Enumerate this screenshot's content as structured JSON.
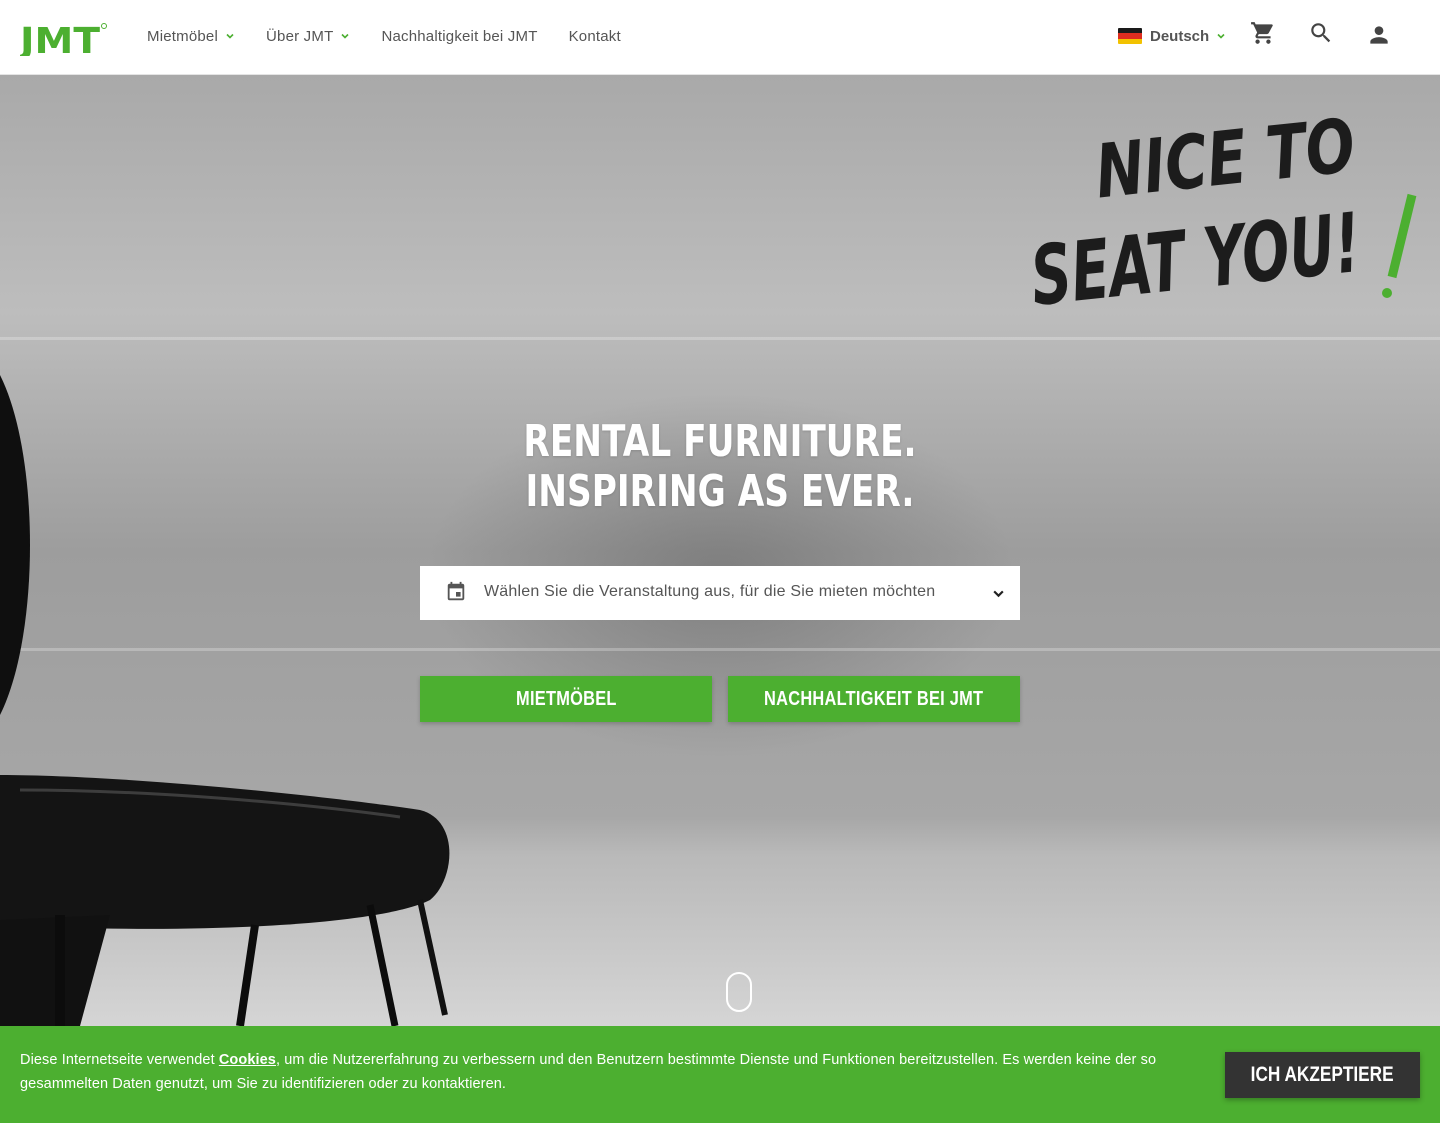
{
  "brand": {
    "logo_text": "JMT",
    "accent_color": "#4caf30",
    "dark_color": "#333333"
  },
  "header": {
    "nav": [
      {
        "label": "Mietmöbel",
        "has_dropdown": true
      },
      {
        "label": "Über JMT",
        "has_dropdown": true
      },
      {
        "label": "Nachhaltigkeit bei JMT",
        "has_dropdown": false
      },
      {
        "label": "Kontakt",
        "has_dropdown": false
      }
    ],
    "language": {
      "label": "Deutsch",
      "flag_icon": "germany-flag-icon"
    },
    "icons": [
      "cart-icon",
      "search-icon",
      "account-icon"
    ]
  },
  "hero": {
    "slogan_lines": [
      "NICE TO",
      "SEAT YOU!"
    ],
    "headline_line1": "RENTAL FURNITURE.",
    "headline_line2": "INSPIRING AS EVER.",
    "event_select_placeholder": "Wählen Sie die Veranstaltung aus, für die Sie mieten möchten",
    "cta_primary": "MIETMÖBEL",
    "cta_secondary": "NACHHALTIGKEIT BEI JMT"
  },
  "cookie_banner": {
    "text_before": "Diese Internetseite verwendet ",
    "link_label": "Cookies",
    "text_after": ", um die Nutzererfahrung zu verbessern und den Benutzern bestimmte Dienste und Funktionen bereitzustellen. Es werden keine der so gesammelten Daten genutzt, um Sie zu identifizieren oder zu kontaktieren.",
    "accept_label": "ICH AKZEPTIERE"
  }
}
